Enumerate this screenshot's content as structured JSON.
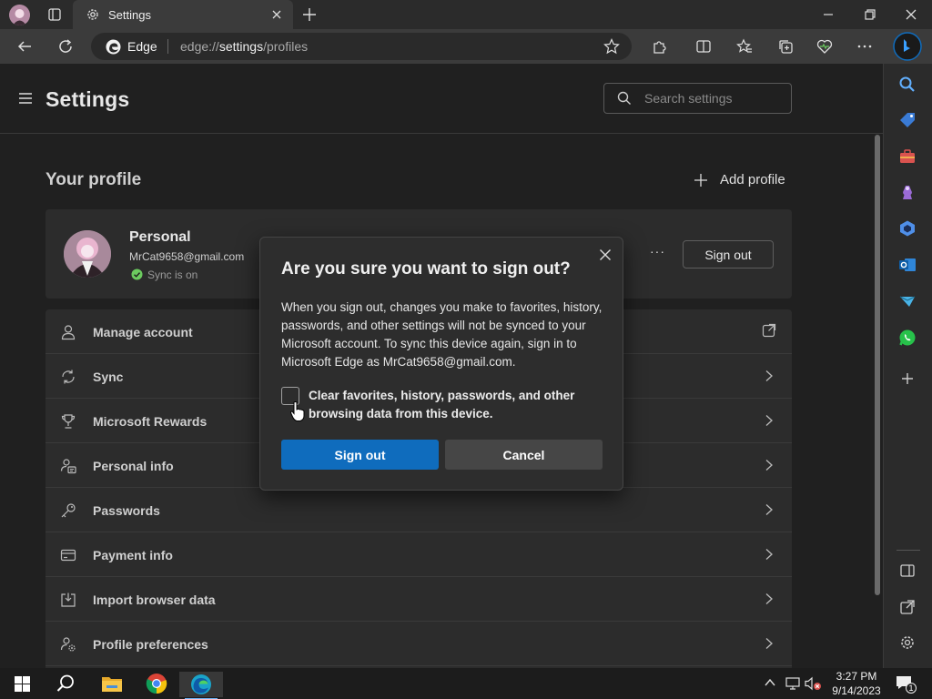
{
  "browser": {
    "tab": {
      "title": "Settings"
    },
    "address": {
      "brand": "Edge",
      "url_prefix": "edge://",
      "url_bold": "settings",
      "url_suffix": "/profiles"
    }
  },
  "settings": {
    "title": "Settings",
    "search_placeholder": "Search settings",
    "section_title": "Your profile",
    "add_profile": "Add profile",
    "profile": {
      "name": "Personal",
      "email": "MrCat9658@gmail.com",
      "sync_status": "Sync is on",
      "more": "···",
      "signout_label": "Sign out"
    },
    "items": [
      {
        "label": "Manage account",
        "icon": "person-icon",
        "trail": "external-link-icon"
      },
      {
        "label": "Sync",
        "icon": "sync-icon",
        "trail": "chevron-right-icon"
      },
      {
        "label": "Microsoft Rewards",
        "icon": "trophy-icon",
        "trail": "chevron-right-icon"
      },
      {
        "label": "Personal info",
        "icon": "person-card-icon",
        "trail": "chevron-right-icon"
      },
      {
        "label": "Passwords",
        "icon": "key-icon",
        "trail": "chevron-right-icon"
      },
      {
        "label": "Payment info",
        "icon": "credit-card-icon",
        "trail": "chevron-right-icon"
      },
      {
        "label": "Import browser data",
        "icon": "import-icon",
        "trail": "chevron-right-icon"
      },
      {
        "label": "Profile preferences",
        "icon": "person-settings-icon",
        "trail": "chevron-right-icon"
      }
    ]
  },
  "dialog": {
    "title": "Are you sure you want to sign out?",
    "body": "When you sign out, changes you make to favorites, history, passwords, and other settings will not be synced to your Microsoft account. To sync this device again, sign in to Microsoft Edge as MrCat9658@gmail.com.",
    "checkbox_label": "Clear favorites, history, passwords, and other browsing data from this device.",
    "checkbox_checked": false,
    "confirm_label": "Sign out",
    "cancel_label": "Cancel"
  },
  "taskbar": {
    "time": "3:27 PM",
    "date": "9/14/2023",
    "notification_count": "1"
  },
  "colors": {
    "accent": "#0f6cbd",
    "background": "#202020",
    "card": "#2c2c2c",
    "sync_ok": "#6ccb5f"
  }
}
